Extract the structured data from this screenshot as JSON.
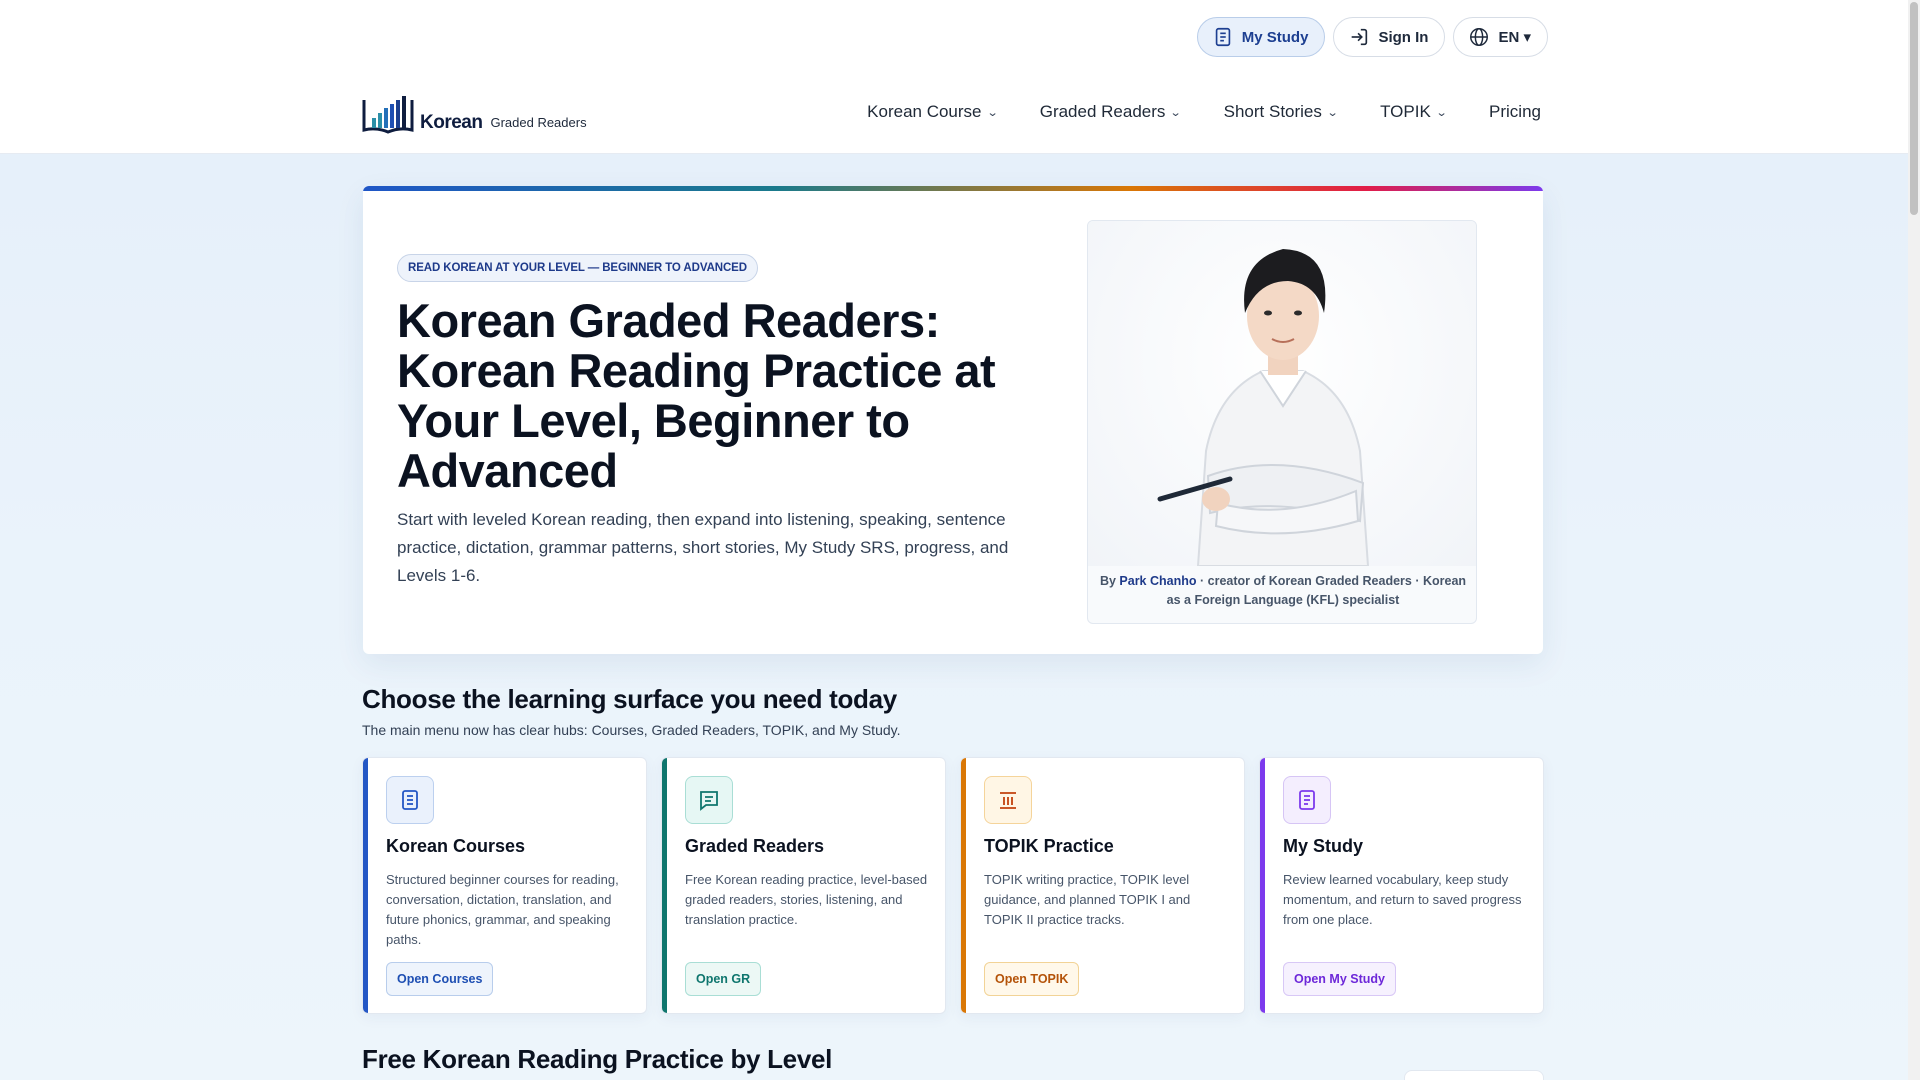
{
  "header": {
    "utility": {
      "my_study": "My Study",
      "sign_in": "Sign In",
      "language": "EN ▾"
    },
    "logo": {
      "word1": "Korean",
      "word2": "Graded Readers"
    },
    "nav": [
      {
        "label": "Korean Course",
        "has_dropdown": true
      },
      {
        "label": "Graded Readers",
        "has_dropdown": true
      },
      {
        "label": "Short Stories",
        "has_dropdown": true
      },
      {
        "label": "TOPIK",
        "has_dropdown": true
      },
      {
        "label": "Pricing",
        "has_dropdown": false
      }
    ],
    "chevron": "⌄"
  },
  "hero": {
    "badge": "READ KOREAN AT YOUR LEVEL — BEGINNER TO ADVANCED",
    "title": "Korean Graded Readers: Korean Reading Practice at Your Level, Beginner to Advanced",
    "description": "Start with leveled Korean reading, then expand into listening, speaking, sentence practice, dictation, grammar patterns, short stories, My Study SRS, progress, and Levels 1-6.",
    "caption_prefix": "By ",
    "caption_name": "Park Chanho",
    "caption_rest": " · creator of Korean Graded Readers · Korean as a Foreign Language (KFL) specialist"
  },
  "surfaces": {
    "title": "Choose the learning surface you need today",
    "subtitle": "The main menu now has clear hubs: Courses, Graded Readers, TOPIK, and My Study.",
    "cards": [
      {
        "title": "Korean Courses",
        "description": "Structured beginner courses for reading, conversation, dictation, translation, and future phonics, grammar, and speaking paths.",
        "button": "Open Courses",
        "icon": "document-icon",
        "accent": "#2457c5",
        "icon_bg": "#eaf1fc",
        "icon_border": "#bcd0ef",
        "icon_color": "#2457c5",
        "btn_bg": "#eef4fc",
        "btn_border": "#b8cdec",
        "btn_color": "#1e4fb3"
      },
      {
        "title": "Graded Readers",
        "description": "Free Korean reading practice, level-based graded readers, stories, listening, and translation practice.",
        "button": "Open GR",
        "icon": "message-icon",
        "accent": "#0f766e",
        "icon_bg": "#e6f7f4",
        "icon_border": "#a9ded5",
        "icon_color": "#0f766e",
        "btn_bg": "#ecf8f5",
        "btn_border": "#a9ded5",
        "btn_color": "#0f766e"
      },
      {
        "title": "TOPIK Practice",
        "description": "TOPIK writing practice, TOPIK level guidance, and planned TOPIK I and TOPIK II practice tracks.",
        "button": "Open TOPIK",
        "icon": "columns-icon",
        "accent": "#d97706",
        "icon_bg": "#fff6e5",
        "icon_border": "#f5d49a",
        "icon_color": "#c2410c",
        "btn_bg": "#fff8ea",
        "btn_border": "#f2d396",
        "btn_color": "#b45309"
      },
      {
        "title": "My Study",
        "description": "Review learned vocabulary, keep study momentum, and return to saved progress from one place.",
        "button": "Open My Study",
        "icon": "notebook-icon",
        "accent": "#7c3aed",
        "icon_bg": "#f4eefe",
        "icon_border": "#d6c5f5",
        "icon_color": "#7c3aed",
        "btn_bg": "#f6f1fe",
        "btn_border": "#d8c8f6",
        "btn_color": "#6d28d9"
      }
    ]
  },
  "next_section": {
    "title": "Free Korean Reading Practice by Level"
  }
}
